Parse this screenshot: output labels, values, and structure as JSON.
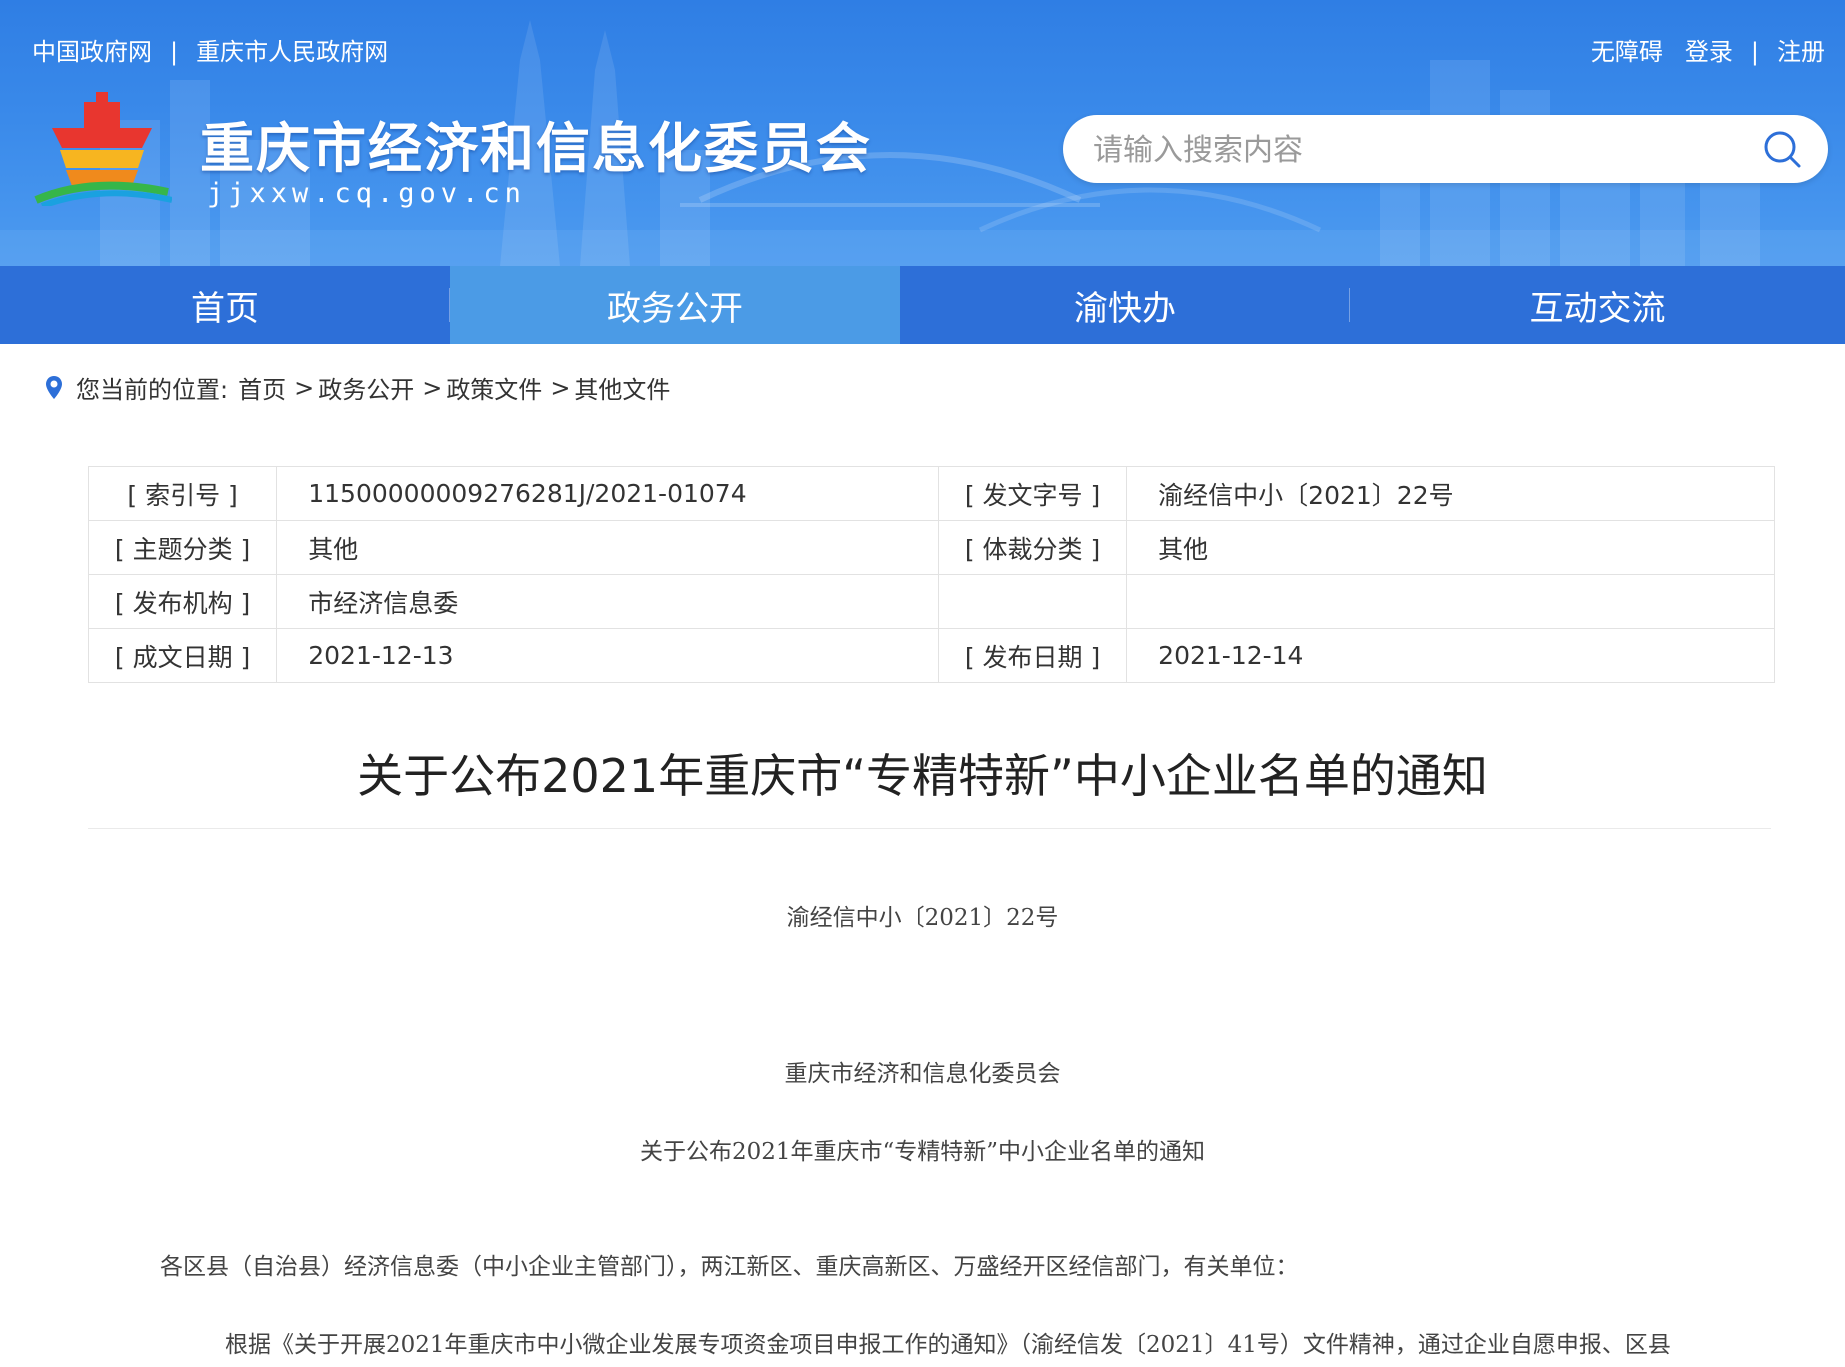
{
  "header": {
    "left_links": [
      "中国政府网",
      "重庆市人民政府网"
    ],
    "right_links": [
      "无障碍",
      "登录",
      "注册"
    ],
    "site_title": "重庆市经济和信息化委员会",
    "site_domain": "jjxxw.cq.gov.cn",
    "search_placeholder": "请输入搜索内容"
  },
  "nav": {
    "items": [
      "首页",
      "政务公开",
      "渝快办",
      "互动交流"
    ],
    "active": "政务公开"
  },
  "breadcrumb": {
    "prefix": "您当前的位置:",
    "items": [
      "首页",
      "政务公开",
      "政策文件",
      "其他文件"
    ]
  },
  "meta": {
    "rows": [
      [
        {
          "label": "[ 索引号 ]",
          "value": "11500000009276281J/2021-01074"
        },
        {
          "label": "[ 发文字号 ]",
          "value": "渝经信中小〔2021〕22号"
        }
      ],
      [
        {
          "label": "[ 主题分类 ]",
          "value": "其他"
        },
        {
          "label": "[ 体裁分类 ]",
          "value": "其他"
        }
      ],
      [
        {
          "label": "[ 发布机构 ]",
          "value": "市经济信息委"
        },
        {
          "label": "",
          "value": ""
        }
      ],
      [
        {
          "label": "[ 成文日期 ]",
          "value": "2021-12-13"
        },
        {
          "label": "[ 发布日期 ]",
          "value": "2021-12-14"
        }
      ]
    ]
  },
  "article": {
    "title": "关于公布2021年重庆市“专精特新”中小企业名单的通知",
    "doc_number": "渝经信中小〔2021〕22号",
    "issuer": "重庆市经济和信息化委员会",
    "subtitle": "关于公布2021年重庆市“专精特新”中小企业名单的通知",
    "salutation": "各区县（自治县）经济信息委（中小企业主管部门），两江新区、重庆高新区、万盛经开区经信部门，有关单位：",
    "paragraph1": "根据《关于开展2021年重庆市中小微企业发展专项资金项目申报工作的通知》（渝经信发〔2021〕41号）文件精神，通过企业自愿申报、区县"
  },
  "colors": {
    "banner_blue": "#2f7ee4",
    "nav_blue": "#2d6fd8",
    "nav_active": "#4b9be6"
  }
}
